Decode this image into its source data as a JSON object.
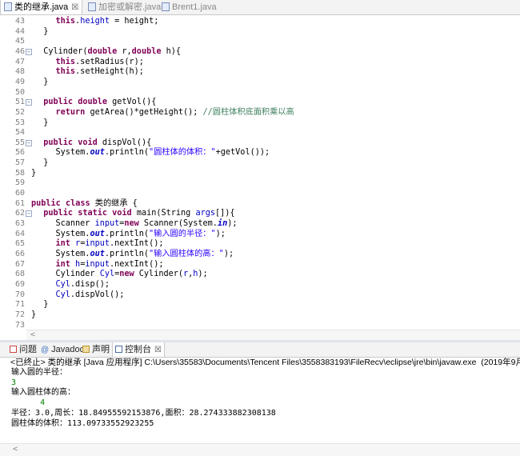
{
  "editor_tabs": [
    {
      "label": "类的继承.java",
      "close": "☒",
      "active": true,
      "icon": "java-file-icon"
    },
    {
      "label": "加密或解密.java",
      "active": false,
      "icon": "java-file-icon"
    },
    {
      "label": "Brent1.java",
      "active": false,
      "icon": "java-file-icon"
    }
  ],
  "code_lines": [
    {
      "n": "43",
      "indent": 8,
      "fold": "",
      "tokens": [
        {
          "t": "this",
          "c": "kw"
        },
        {
          "t": "."
        },
        {
          "t": "height",
          "c": "fd"
        },
        {
          "t": " = height;"
        }
      ]
    },
    {
      "n": "44",
      "indent": 4,
      "fold": "",
      "tokens": [
        {
          "t": "}"
        }
      ]
    },
    {
      "n": "45",
      "indent": 0,
      "fold": "",
      "tokens": []
    },
    {
      "n": "46",
      "indent": 4,
      "fold": "⊖",
      "tokens": [
        {
          "t": "Cylinder("
        },
        {
          "t": "double",
          "c": "kw"
        },
        {
          "t": " r,"
        },
        {
          "t": "double",
          "c": "kw"
        },
        {
          "t": " h){"
        }
      ]
    },
    {
      "n": "47",
      "indent": 8,
      "fold": "",
      "tokens": [
        {
          "t": "this",
          "c": "kw"
        },
        {
          "t": ".setRadius(r);"
        }
      ]
    },
    {
      "n": "48",
      "indent": 8,
      "fold": "",
      "tokens": [
        {
          "t": "this",
          "c": "kw"
        },
        {
          "t": ".setHeight(h);"
        }
      ]
    },
    {
      "n": "49",
      "indent": 4,
      "fold": "",
      "tokens": [
        {
          "t": "}"
        }
      ]
    },
    {
      "n": "50",
      "indent": 0,
      "fold": "",
      "tokens": []
    },
    {
      "n": "51",
      "indent": 4,
      "fold": "⊖",
      "tokens": [
        {
          "t": "public",
          "c": "kw"
        },
        {
          "t": " "
        },
        {
          "t": "double",
          "c": "kw"
        },
        {
          "t": " getVol(){"
        }
      ]
    },
    {
      "n": "52",
      "indent": 8,
      "fold": "",
      "tokens": [
        {
          "t": "return",
          "c": "kw"
        },
        {
          "t": " getArea()*getHeight(); "
        },
        {
          "t": "//圆柱体积底面积乘以高",
          "c": "cm"
        }
      ]
    },
    {
      "n": "53",
      "indent": 4,
      "fold": "",
      "tokens": [
        {
          "t": "}"
        }
      ]
    },
    {
      "n": "54",
      "indent": 0,
      "fold": "",
      "tokens": []
    },
    {
      "n": "55",
      "indent": 4,
      "fold": "⊖",
      "tokens": [
        {
          "t": "public",
          "c": "kw"
        },
        {
          "t": " "
        },
        {
          "t": "void",
          "c": "kw"
        },
        {
          "t": " dispVol(){"
        }
      ]
    },
    {
      "n": "56",
      "indent": 8,
      "fold": "",
      "tokens": [
        {
          "t": "System."
        },
        {
          "t": "out",
          "c": "fdi"
        },
        {
          "t": ".println("
        },
        {
          "t": "\"圆柱体的体积：\"",
          "c": "str"
        },
        {
          "t": "+getVol());"
        }
      ]
    },
    {
      "n": "57",
      "indent": 4,
      "fold": "",
      "tokens": [
        {
          "t": "}"
        }
      ]
    },
    {
      "n": "58",
      "indent": 0,
      "fold": "",
      "tokens": [
        {
          "t": "}"
        }
      ]
    },
    {
      "n": "59",
      "indent": 0,
      "fold": "",
      "tokens": []
    },
    {
      "n": "60",
      "indent": 0,
      "fold": "",
      "tokens": []
    },
    {
      "n": "61",
      "indent": 0,
      "fold": "",
      "tokens": [
        {
          "t": "public",
          "c": "kw"
        },
        {
          "t": " "
        },
        {
          "t": "class",
          "c": "kw"
        },
        {
          "t": " 类的继承 {"
        }
      ]
    },
    {
      "n": "62",
      "indent": 4,
      "fold": "⊖",
      "tokens": [
        {
          "t": "public",
          "c": "kw"
        },
        {
          "t": " "
        },
        {
          "t": "static",
          "c": "kw"
        },
        {
          "t": " "
        },
        {
          "t": "void",
          "c": "kw"
        },
        {
          "t": " main(String "
        },
        {
          "t": "args",
          "c": "fd"
        },
        {
          "t": "[]){"
        }
      ]
    },
    {
      "n": "63",
      "indent": 8,
      "fold": "",
      "tokens": [
        {
          "t": "Scanner "
        },
        {
          "t": "input",
          "c": "fd"
        },
        {
          "t": "="
        },
        {
          "t": "new",
          "c": "kw"
        },
        {
          "t": " Scanner(System."
        },
        {
          "t": "in",
          "c": "fdi"
        },
        {
          "t": ");"
        }
      ]
    },
    {
      "n": "64",
      "indent": 8,
      "fold": "",
      "tokens": [
        {
          "t": "System."
        },
        {
          "t": "out",
          "c": "fdi"
        },
        {
          "t": ".println("
        },
        {
          "t": "\"输入圆的半径：\"",
          "c": "str"
        },
        {
          "t": ");"
        }
      ]
    },
    {
      "n": "65",
      "indent": 8,
      "fold": "",
      "tokens": [
        {
          "t": "int",
          "c": "kw"
        },
        {
          "t": " "
        },
        {
          "t": "r",
          "c": "fd"
        },
        {
          "t": "="
        },
        {
          "t": "input",
          "c": "fd"
        },
        {
          "t": ".nextInt();"
        }
      ]
    },
    {
      "n": "66",
      "indent": 8,
      "fold": "",
      "tokens": [
        {
          "t": "System."
        },
        {
          "t": "out",
          "c": "fdi"
        },
        {
          "t": ".println("
        },
        {
          "t": "\"输入圆柱体的高：\"",
          "c": "str"
        },
        {
          "t": ");"
        }
      ]
    },
    {
      "n": "67",
      "indent": 8,
      "fold": "",
      "tokens": [
        {
          "t": "int",
          "c": "kw"
        },
        {
          "t": " "
        },
        {
          "t": "h",
          "c": "fd"
        },
        {
          "t": "="
        },
        {
          "t": "input",
          "c": "fd"
        },
        {
          "t": ".nextInt();"
        }
      ]
    },
    {
      "n": "68",
      "indent": 8,
      "fold": "",
      "tokens": [
        {
          "t": "Cylinder "
        },
        {
          "t": "Cyl",
          "c": "fd"
        },
        {
          "t": "="
        },
        {
          "t": "new",
          "c": "kw"
        },
        {
          "t": " Cylinder("
        },
        {
          "t": "r",
          "c": "fd"
        },
        {
          "t": ","
        },
        {
          "t": "h",
          "c": "fd"
        },
        {
          "t": ");"
        }
      ]
    },
    {
      "n": "69",
      "indent": 8,
      "fold": "",
      "tokens": [
        {
          "t": "Cyl",
          "c": "fd"
        },
        {
          "t": ".disp();"
        }
      ]
    },
    {
      "n": "70",
      "indent": 8,
      "fold": "",
      "tokens": [
        {
          "t": "Cyl",
          "c": "fd"
        },
        {
          "t": ".dispVol();"
        }
      ]
    },
    {
      "n": "71",
      "indent": 4,
      "fold": "",
      "tokens": [
        {
          "t": "}"
        }
      ]
    },
    {
      "n": "72",
      "indent": 0,
      "fold": "",
      "tokens": [
        {
          "t": "}"
        }
      ]
    },
    {
      "n": "73",
      "indent": 0,
      "fold": "",
      "tokens": []
    }
  ],
  "editor_hscroll_arrow": "<",
  "console_tabs": [
    {
      "label": "问题",
      "icon": "problems-icon",
      "active": false
    },
    {
      "label": "Javadoc",
      "icon": "javadoc-icon",
      "active": false
    },
    {
      "label": "声明",
      "icon": "declaration-icon",
      "active": false
    },
    {
      "label": "控制台",
      "icon": "console-icon",
      "active": true,
      "close": "☒"
    }
  ],
  "console": {
    "terminated": "<已终止> 类的继承 [Java 应用程序] C:\\Users\\35583\\Documents\\Tencent Files\\3558383193\\FileRecv\\eclipse\\jre\\bin\\javaw.exe  (2019年9月29日",
    "lines": [
      {
        "text": "输入圆的半径：",
        "kind": "out"
      },
      {
        "text": "3",
        "kind": "in"
      },
      {
        "text": "输入圆柱体的高：",
        "kind": "out"
      },
      {
        "text": "      4",
        "kind": "in"
      },
      {
        "text": "半径：3.0,周长：18.84955592153876,面积：28.274333882308138",
        "kind": "out"
      },
      {
        "text": "圆柱体的体积：113.09733552923255",
        "kind": "out"
      }
    ],
    "hscroll_arrow": "<"
  },
  "colors": {
    "keyword": "#7f0055",
    "field": "#0000c0",
    "string": "#2a00ff",
    "comment": "#3f7f5f",
    "console_input": "#008000"
  }
}
